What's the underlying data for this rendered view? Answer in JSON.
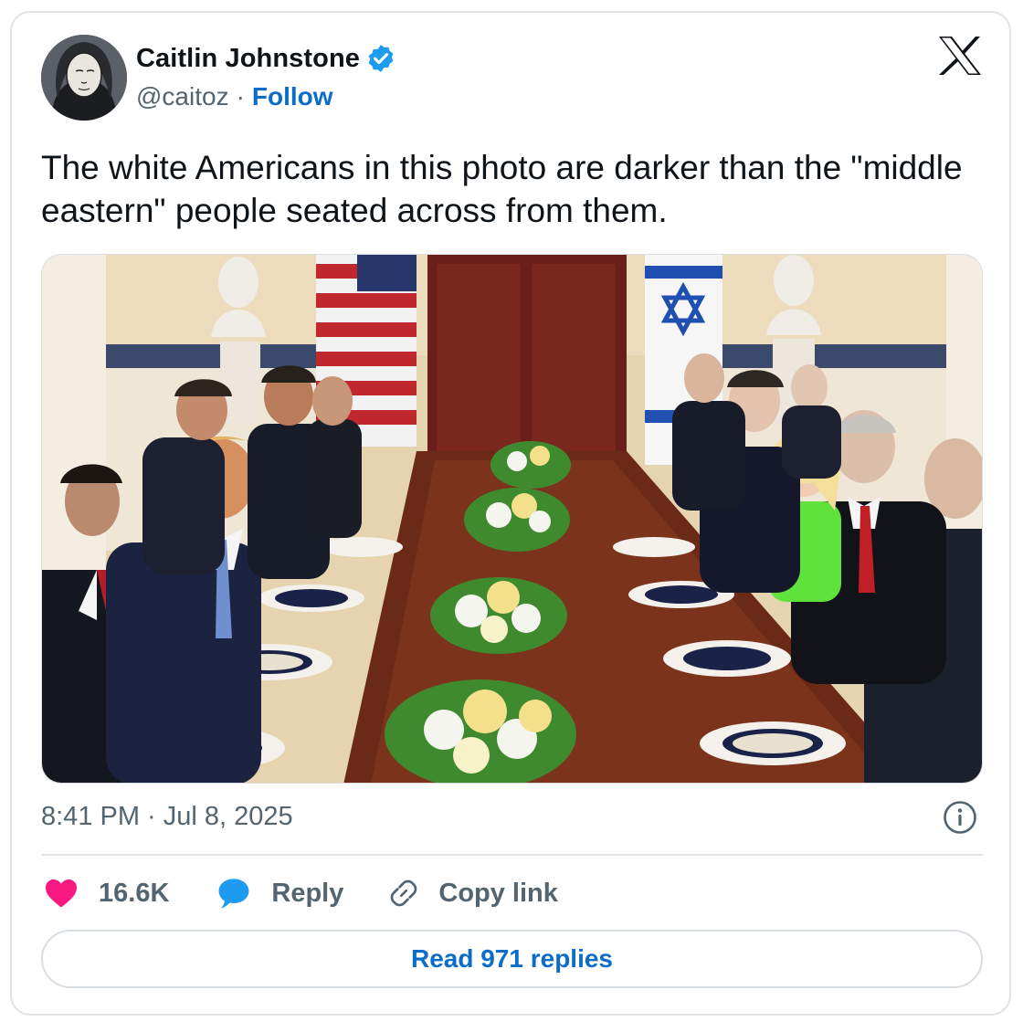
{
  "author": {
    "name": "Caitlin Johnstone",
    "handle": "@caitoz",
    "separator": "·",
    "follow_label": "Follow",
    "verified_icon": "verified-badge-icon",
    "verified_color": "#1d9bf0"
  },
  "platform_icon": "x-logo-icon",
  "tweet": {
    "text": "The white Americans in this photo are darker than the \"middle eastern\" people seated across from them.",
    "timestamp": "8:41 PM · Jul 8, 2025"
  },
  "actions": {
    "like_count": "16.6K",
    "like_icon": "heart-icon",
    "like_color": "#f91880",
    "reply_label": "Reply",
    "reply_icon": "speech-bubble-icon",
    "reply_color": "#1d9bf0",
    "copy_label": "Copy link",
    "copy_icon": "link-icon"
  },
  "read_replies_label": "Read 971 replies",
  "accent_color": "#0b6cc9"
}
